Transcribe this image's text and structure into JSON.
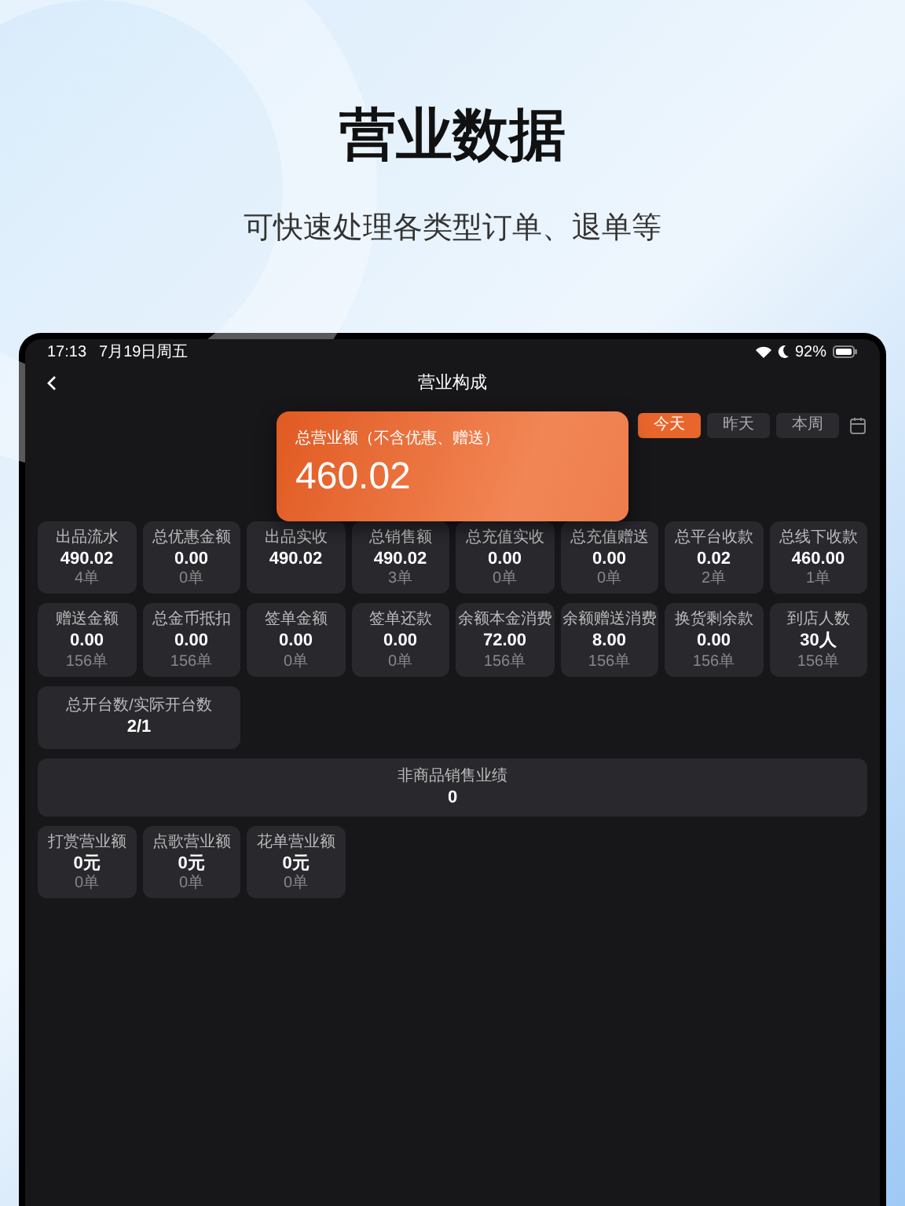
{
  "headline": "营业数据",
  "subheadline": "可快速处理各类型订单、退单等",
  "status_bar": {
    "time": "17:13",
    "date": "7月19日周五",
    "battery": "92%"
  },
  "nav": {
    "title": "营业构成"
  },
  "period_tabs": [
    {
      "label": "今天",
      "selected": true
    },
    {
      "label": "昨天",
      "selected": false
    },
    {
      "label": "本周",
      "selected": false
    }
  ],
  "highlight_card": {
    "label": "总营业额（不含优惠、赠送）",
    "value": "460.02"
  },
  "rows": [
    {
      "kind": "grid",
      "tiles": [
        {
          "label": "出品流水",
          "value": "490.02",
          "count": "4单"
        },
        {
          "label": "总优惠金额",
          "value": "0.00",
          "count": "0单"
        },
        {
          "label": "出品实收",
          "value": "490.02"
        },
        {
          "label": "总销售额",
          "value": "490.02",
          "count": "3单"
        },
        {
          "label": "总充值实收",
          "value": "0.00",
          "count": "0单"
        },
        {
          "label": "总充值赠送",
          "value": "0.00",
          "count": "0单"
        },
        {
          "label": "总平台收款",
          "value": "0.02",
          "count": "2单"
        },
        {
          "label": "总线下收款",
          "value": "460.00",
          "count": "1单"
        }
      ]
    },
    {
      "kind": "grid",
      "tiles": [
        {
          "label": "赠送金额",
          "value": "0.00",
          "count": "156单"
        },
        {
          "label": "总金币抵扣",
          "value": "0.00",
          "count": "156单"
        },
        {
          "label": "签单金额",
          "value": "0.00",
          "count": "0单"
        },
        {
          "label": "签单还款",
          "value": "0.00",
          "count": "0单"
        },
        {
          "label": "余额本金消费",
          "value": "72.00",
          "count": "156单"
        },
        {
          "label": "余额赠送消费",
          "value": "8.00",
          "count": "156单"
        },
        {
          "label": "换货剩余款",
          "value": "0.00",
          "count": "156单"
        },
        {
          "label": "到店人数",
          "value": "30人",
          "count": "156单"
        }
      ]
    },
    {
      "kind": "double",
      "tiles": [
        {
          "label": "总开台数/实际开台数",
          "value": "2/1"
        }
      ]
    },
    {
      "kind": "full",
      "tiles": [
        {
          "label": "非商品销售业绩",
          "value": "0"
        }
      ]
    },
    {
      "kind": "grid",
      "tiles": [
        {
          "label": "打赏营业额",
          "value": "0元",
          "count": "0单"
        },
        {
          "label": "点歌营业额",
          "value": "0元",
          "count": "0单"
        },
        {
          "label": "花单营业额",
          "value": "0元",
          "count": "0单"
        }
      ]
    }
  ]
}
